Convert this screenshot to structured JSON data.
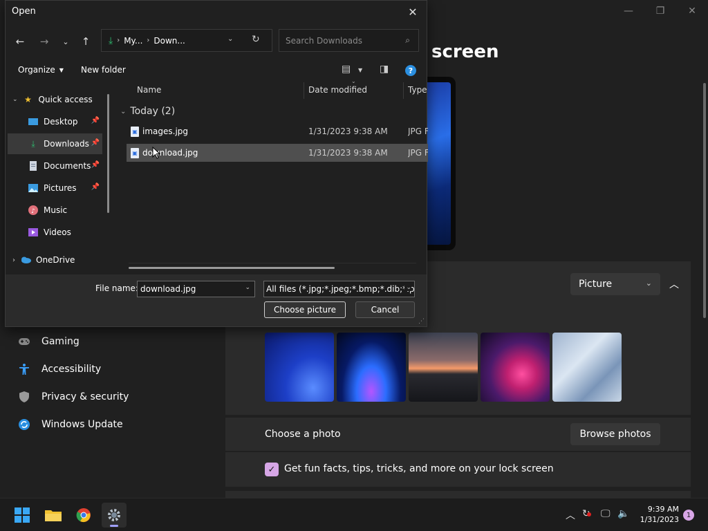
{
  "settings": {
    "page_title": "screen",
    "window_controls": {
      "minimize": "—",
      "maximize": "❐",
      "close": "✕"
    },
    "nav": [
      {
        "label": "Gaming",
        "icon": "gamepad-icon"
      },
      {
        "label": "Accessibility",
        "icon": "accessibility-icon"
      },
      {
        "label": "Privacy & security",
        "icon": "shield-icon"
      },
      {
        "label": "Windows Update",
        "icon": "update-icon"
      }
    ],
    "personalize_dropdown": "Picture",
    "choose_photo_label": "Choose a photo",
    "browse_button": "Browse photos",
    "tips_label": "Get fun facts, tips, tricks, and more on your lock screen",
    "tips_checked": true,
    "thumbnails": [
      "wallpaper-bloom-blue",
      "wallpaper-glow-purple",
      "wallpaper-sunset-lake",
      "wallpaper-swirl-pink",
      "wallpaper-bloom-light"
    ]
  },
  "dialog": {
    "title": "Open",
    "address": {
      "part1": "My...",
      "part2": "Down..."
    },
    "search_placeholder": "Search Downloads",
    "toolbar": {
      "organize": "Organize",
      "new_folder": "New folder"
    },
    "sidebar": [
      {
        "label": "Quick access",
        "icon": "star-icon",
        "pinned": false
      },
      {
        "label": "Desktop",
        "icon": "desktop-icon",
        "pinned": true
      },
      {
        "label": "Downloads",
        "icon": "download-icon",
        "pinned": true,
        "active": true
      },
      {
        "label": "Documents",
        "icon": "document-icon",
        "pinned": true
      },
      {
        "label": "Pictures",
        "icon": "pictures-icon",
        "pinned": true
      },
      {
        "label": "Music",
        "icon": "music-icon",
        "pinned": false
      },
      {
        "label": "Videos",
        "icon": "videos-icon",
        "pinned": false
      },
      {
        "label": "OneDrive",
        "icon": "cloud-icon",
        "pinned": false
      }
    ],
    "columns": {
      "name": "Name",
      "date": "Date modified",
      "type": "Type"
    },
    "group": "Today (2)",
    "files": [
      {
        "name": "images.jpg",
        "date": "1/31/2023 9:38 AM",
        "type": "JPG File"
      },
      {
        "name": "download.jpg",
        "date": "1/31/2023 9:38 AM",
        "type": "JPG File",
        "selected": true
      }
    ],
    "file_name_label": "File name:",
    "file_name_value": "download.jpg",
    "file_type_value": "All files (*.jpg;*.jpeg;*.bmp;*.dib;*.png",
    "choose_button": "Choose picture",
    "cancel_button": "Cancel"
  },
  "taskbar": {
    "apps": [
      "start-icon",
      "file-explorer-icon",
      "chrome-icon",
      "settings-icon"
    ],
    "time": "9:39 AM",
    "date": "1/31/2023",
    "notification_count": "1"
  }
}
